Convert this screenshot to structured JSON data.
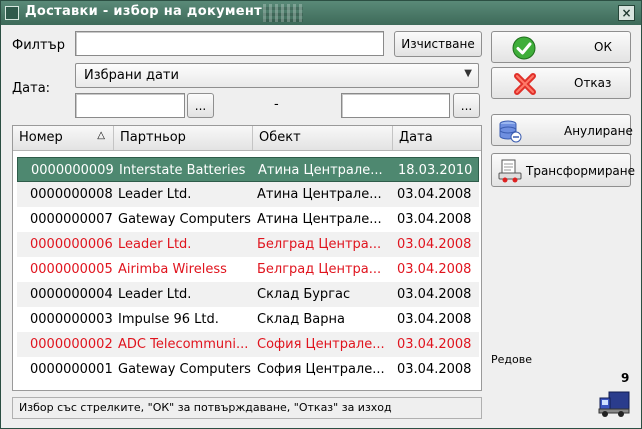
{
  "window": {
    "title": "Доставки - избор на документ",
    "close": "×"
  },
  "filter": {
    "label": "Филтър",
    "value": "",
    "clear_button": "Изчистване"
  },
  "date": {
    "label": "Дата:",
    "selected": "Избрани дати",
    "from_value": "",
    "to_value": "",
    "separator": "-",
    "picker_label": "..."
  },
  "table": {
    "columns": [
      "Номер",
      "Партньор",
      "Обект",
      "Дата"
    ],
    "rows": [
      {
        "number": "0000000009",
        "partner": "Interstate Batteries",
        "site": "Атина Централе...",
        "date": "18.03.2010",
        "state": "selected"
      },
      {
        "number": "0000000008",
        "partner": "Leader Ltd.",
        "site": "Атина Централе...",
        "date": "03.04.2008",
        "state": "normal"
      },
      {
        "number": "0000000007",
        "partner": "Gateway Computers",
        "site": "Атина Централе...",
        "date": "03.04.2008",
        "state": "normal"
      },
      {
        "number": "0000000006",
        "partner": "Leader Ltd.",
        "site": "Белград Центра...",
        "date": "03.04.2008",
        "state": "cancelled"
      },
      {
        "number": "0000000005",
        "partner": "Airimba Wireless",
        "site": "Белград Центра...",
        "date": "03.04.2008",
        "state": "cancelled"
      },
      {
        "number": "0000000004",
        "partner": "Leader Ltd.",
        "site": "Склад Бургас",
        "date": "03.04.2008",
        "state": "normal"
      },
      {
        "number": "0000000003",
        "partner": "Impulse 96 Ltd.",
        "site": "Склад Варна",
        "date": "03.04.2008",
        "state": "normal"
      },
      {
        "number": "0000000002",
        "partner": "ADC Telecommuni...",
        "site": "София Централе...",
        "date": "03.04.2008",
        "state": "cancelled"
      },
      {
        "number": "0000000001",
        "partner": "Gateway Computers",
        "site": "София Централе...",
        "date": "03.04.2008",
        "state": "normal"
      }
    ]
  },
  "status": "Избор със стрелките, \"ОК\" за потвърждаване, \"Отказ\" за изход",
  "actions": {
    "ok": "ОК",
    "cancel": "Отказ",
    "annul": "Анулиране",
    "transform": "Трансформиране"
  },
  "rows_label": "Редове",
  "rows_count": "9",
  "colors": {
    "accent": "#4e8870",
    "cancelled": "#e0141e",
    "title": "#3d6a59"
  },
  "icons": [
    "check-icon",
    "cross-icon",
    "database-icon",
    "transform-icon",
    "truck-icon",
    "sort-ascending-icon",
    "dropdown-arrow-icon"
  ]
}
